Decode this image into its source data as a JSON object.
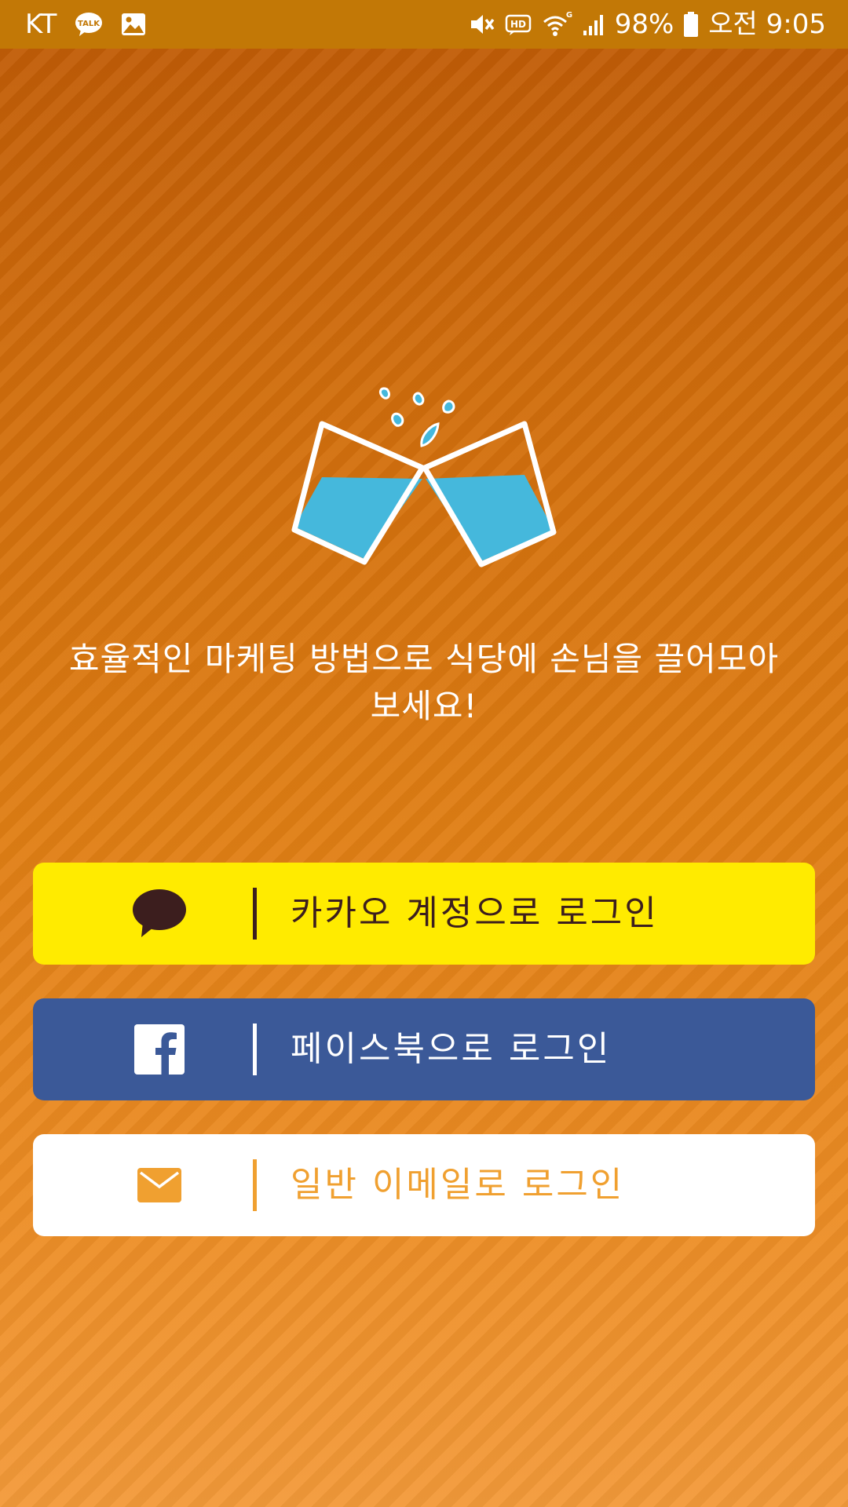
{
  "status_bar": {
    "carrier": "KT",
    "battery": "98%",
    "time": "오전 9:05",
    "icons": [
      "kakaotalk-notification-icon",
      "image-notification-icon",
      "mute-icon",
      "hd-voice-icon",
      "wifi-icon",
      "signal-icon",
      "battery-icon"
    ]
  },
  "logo": {
    "icon": "clinking-glasses-icon",
    "colors": {
      "water": "#45b8dc",
      "outline": "#ffffff"
    }
  },
  "tagline": {
    "line1": "효율적인 마케팅 방법으로 식당에 손님을 끌어모아",
    "line2": "보세요!"
  },
  "login": {
    "kakao": {
      "label": "카카오 계정으로 로그인",
      "icon": "kakao-speech-bubble-icon",
      "color": "#ffeb00"
    },
    "facebook": {
      "label": "페이스북으로 로그인",
      "icon": "facebook-icon",
      "color": "#3b5998"
    },
    "email": {
      "label": "일반 이메일로 로그인",
      "icon": "envelope-icon",
      "color": "#f0a030"
    }
  }
}
